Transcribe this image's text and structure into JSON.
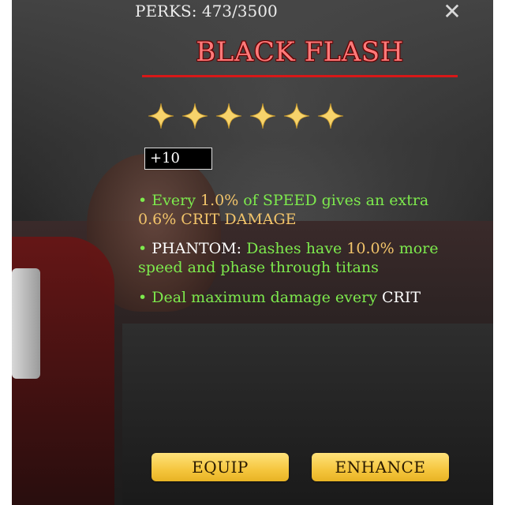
{
  "header": {
    "perks_label": "PERKS: 473/3500",
    "close_symbol": "✕"
  },
  "perk": {
    "title": "BLACK FLASH",
    "stars": 6,
    "max_stars": 6,
    "level": "+10"
  },
  "descriptions": {
    "line1": {
      "bullet": "•",
      "a": "Every ",
      "b": "1.0%",
      "c": " of SPEED gives an extra ",
      "d": "0.6% CRIT DAMAGE"
    },
    "line2": {
      "bullet": "•",
      "a": "PHANTOM:",
      "b": " Dashes have ",
      "c": "10.0%",
      "d": " more speed and phase through titans"
    },
    "line3": {
      "bullet": "•",
      "a": "Deal maximum damage every ",
      "b": "CRIT"
    }
  },
  "buttons": {
    "equip": "EQUIP",
    "enhance": "ENHANCE"
  },
  "colors": {
    "title": "#ff7a7a",
    "title_underline": "#d81818",
    "perk_text_green": "#7dea4d",
    "highlight_orange": "#f2c46a",
    "button_gold": "#f5c63e",
    "star_gold": "#f7d36b"
  },
  "icons": {
    "close": "close-icon",
    "star": "star-icon"
  }
}
